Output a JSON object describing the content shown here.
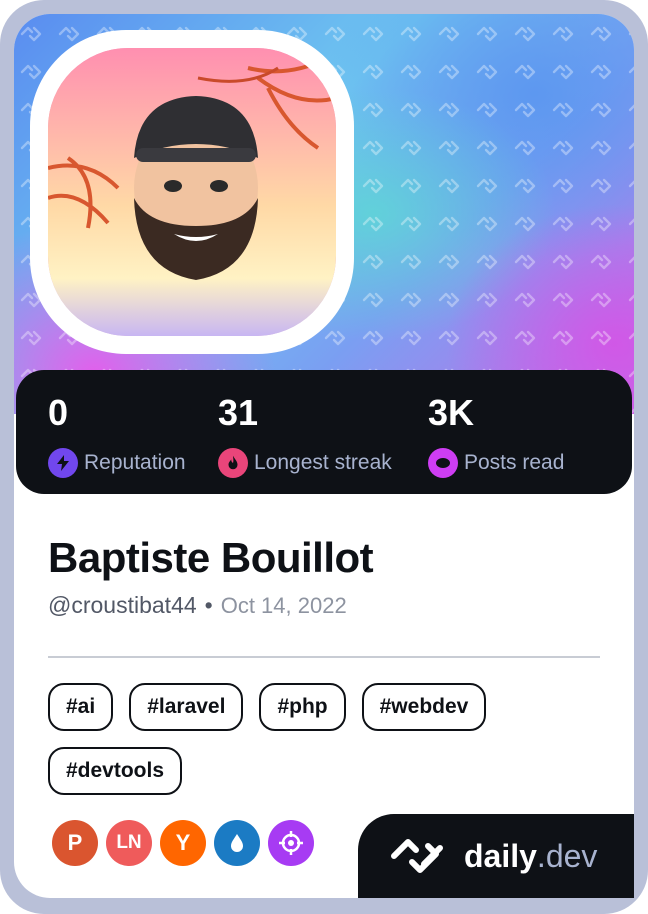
{
  "profile": {
    "name": "Baptiste Bouillot",
    "username": "@croustibat44",
    "separator": "•",
    "joined": "Oct 14, 2022"
  },
  "stats": [
    {
      "value": "0",
      "label": "Reputation",
      "icon": "lightning-icon",
      "color": "#7147ed"
    },
    {
      "value": "31",
      "label": "Longest streak",
      "icon": "flame-icon",
      "color": "#e9457a"
    },
    {
      "value": "3K",
      "label": "Posts read",
      "icon": "eye-icon",
      "color": "#ce3df3"
    }
  ],
  "tags": [
    "#ai",
    "#laravel",
    "#php",
    "#webdev",
    "#devtools"
  ],
  "sources": [
    {
      "icon": "product-hunt-icon",
      "letter": "P",
      "color": "#da552f"
    },
    {
      "icon": "laravel-news-icon",
      "letter": "LN",
      "color": "#ef5b5b"
    },
    {
      "icon": "hacker-news-icon",
      "letter": "Y",
      "color": "#ff6600"
    },
    {
      "icon": "drop-icon",
      "letter": "",
      "color": "#1b7bc4"
    },
    {
      "icon": "crosshair-icon",
      "letter": "",
      "color": "#a73bf3"
    }
  ],
  "brand": {
    "name": "daily",
    "suffix": ".dev"
  }
}
